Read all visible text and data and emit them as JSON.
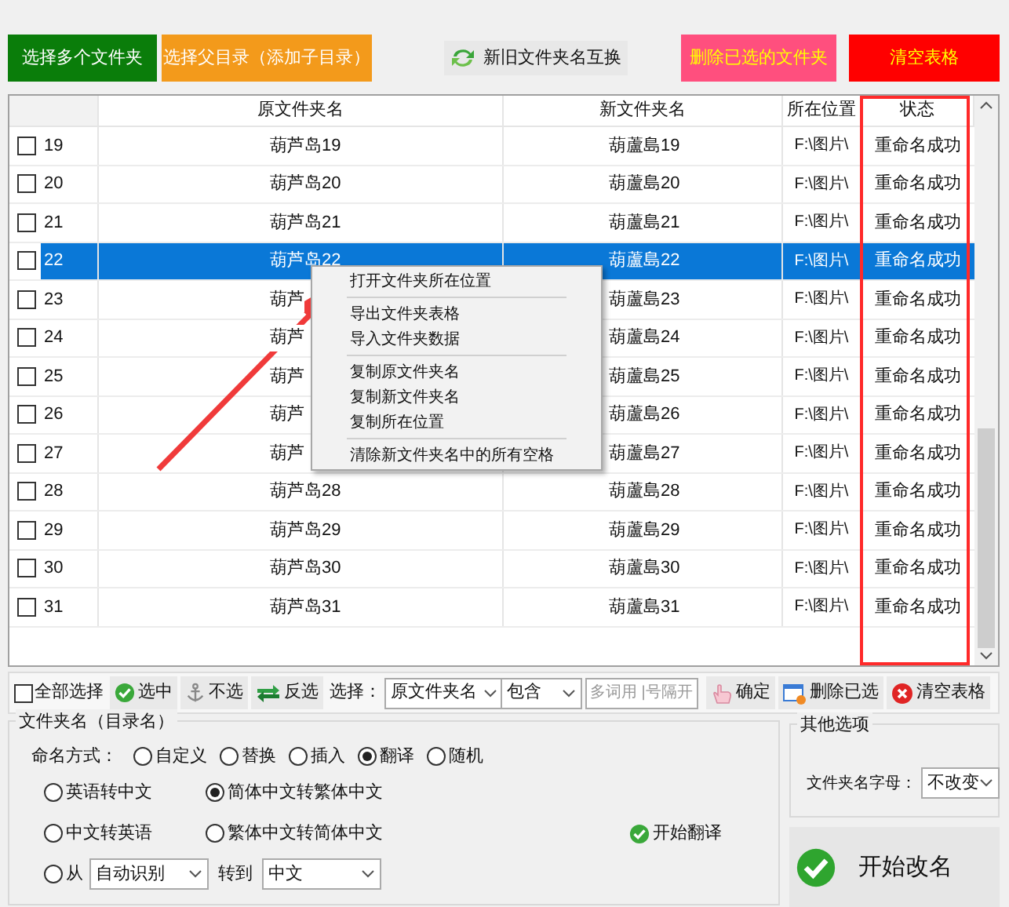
{
  "top_buttons": [
    {
      "label": "选择多个文件夹",
      "kind": "solid",
      "color": "#0a7d0a"
    },
    {
      "label": "选择父目录（添加子目录）",
      "kind": "solid",
      "color": "#f39a1b"
    },
    {
      "label": "新旧文件夹名互换",
      "kind": "swap"
    },
    {
      "label": "删除已选的文件夹",
      "kind": "alert",
      "color": "#ff4f7e"
    },
    {
      "label": "清空表格",
      "kind": "alert",
      "color": "#ff0000"
    }
  ],
  "table": {
    "columns": [
      "原文件夹名",
      "新文件夹名",
      "所在位置",
      "状态"
    ],
    "rows": [
      {
        "number": "19",
        "checked": false,
        "selected": false,
        "original_name": "葫芦岛19",
        "new_name": "葫蘆島19",
        "location": "F:\\图片\\",
        "status": "重命名成功"
      },
      {
        "number": "20",
        "checked": false,
        "selected": false,
        "original_name": "葫芦岛20",
        "new_name": "葫蘆島20",
        "location": "F:\\图片\\",
        "status": "重命名成功"
      },
      {
        "number": "21",
        "checked": false,
        "selected": false,
        "original_name": "葫芦岛21",
        "new_name": "葫蘆島21",
        "location": "F:\\图片\\",
        "status": "重命名成功"
      },
      {
        "number": "22",
        "checked": false,
        "selected": true,
        "original_name": "葫芦岛22",
        "new_name": "葫蘆島22",
        "location": "F:\\图片\\",
        "status": "重命名成功"
      },
      {
        "number": "23",
        "checked": false,
        "selected": false,
        "original_name": "葫芦",
        "new_name": "葫蘆島23",
        "location": "F:\\图片\\",
        "status": "重命名成功"
      },
      {
        "number": "24",
        "checked": false,
        "selected": false,
        "original_name": "葫芦",
        "new_name": "葫蘆島24",
        "location": "F:\\图片\\",
        "status": "重命名成功"
      },
      {
        "number": "25",
        "checked": false,
        "selected": false,
        "original_name": "葫芦",
        "new_name": "葫蘆島25",
        "location": "F:\\图片\\",
        "status": "重命名成功"
      },
      {
        "number": "26",
        "checked": false,
        "selected": false,
        "original_name": "葫芦",
        "new_name": "葫蘆島26",
        "location": "F:\\图片\\",
        "status": "重命名成功"
      },
      {
        "number": "27",
        "checked": false,
        "selected": false,
        "original_name": "葫芦",
        "new_name": "葫蘆島27",
        "location": "F:\\图片\\",
        "status": "重命名成功"
      },
      {
        "number": "28",
        "checked": false,
        "selected": false,
        "original_name": "葫芦岛28",
        "new_name": "葫蘆島28",
        "location": "F:\\图片\\",
        "status": "重命名成功"
      },
      {
        "number": "29",
        "checked": false,
        "selected": false,
        "original_name": "葫芦岛29",
        "new_name": "葫蘆島29",
        "location": "F:\\图片\\",
        "status": "重命名成功"
      },
      {
        "number": "30",
        "checked": false,
        "selected": false,
        "original_name": "葫芦岛30",
        "new_name": "葫蘆島30",
        "location": "F:\\图片\\",
        "status": "重命名成功"
      },
      {
        "number": "31",
        "checked": false,
        "selected": false,
        "original_name": "葫芦岛31",
        "new_name": "葫蘆島31",
        "location": "F:\\图片\\",
        "status": "重命名成功"
      }
    ]
  },
  "context_menu": {
    "groups": [
      [
        "打开文件夹所在位置"
      ],
      [
        "导出文件夹表格",
        "导入文件夹数据"
      ],
      [
        "复制原文件夹名",
        "复制新文件夹名",
        "复制所在位置"
      ],
      [
        "清除新文件夹名中的所有空格"
      ]
    ]
  },
  "select_toolbar": {
    "select_all": {
      "label": "全部选择",
      "checked": false
    },
    "items": [
      {
        "kind": "check",
        "label": "选中"
      },
      {
        "kind": "anchor",
        "label": "不选"
      },
      {
        "kind": "invert",
        "label": "反选"
      },
      {
        "kind": "label",
        "label": "选择："
      },
      {
        "kind": "dropdown",
        "value": "原文件夹名"
      },
      {
        "kind": "dropdown",
        "value": "包含"
      },
      {
        "kind": "input",
        "placeholder": "多词用 |号隔开"
      },
      {
        "kind": "hand",
        "label": "确定"
      },
      {
        "kind": "window",
        "label": "删除已选"
      },
      {
        "kind": "close",
        "label": "清空表格"
      }
    ]
  },
  "naming_group": {
    "title": "文件夹名（目录名）",
    "mode_label": "命名方式：",
    "modes": [
      {
        "label": "自定义",
        "selected": false
      },
      {
        "label": "替换",
        "selected": false
      },
      {
        "label": "插入",
        "selected": false
      },
      {
        "label": "翻译",
        "selected": true
      },
      {
        "label": "随机",
        "selected": false
      }
    ],
    "translate_options": [
      {
        "kind": "plain",
        "label": "英语转中文",
        "selected": false
      },
      {
        "kind": "plain",
        "label": "简体中文转繁体中文",
        "selected": true
      },
      {
        "kind": "plain",
        "label": "中文转英语",
        "selected": false
      },
      {
        "kind": "plain",
        "label": "繁体中文转简体中文",
        "selected": false
      },
      {
        "kind": "range",
        "label": "从",
        "selected": false,
        "source": "自动识别",
        "to_label": "转到",
        "target": "中文"
      }
    ],
    "translate_button": "开始翻译"
  },
  "other_options": {
    "title": "其他选项",
    "field_label": "文件夹名字母：",
    "value": "不改变"
  },
  "start_button": "开始改名"
}
